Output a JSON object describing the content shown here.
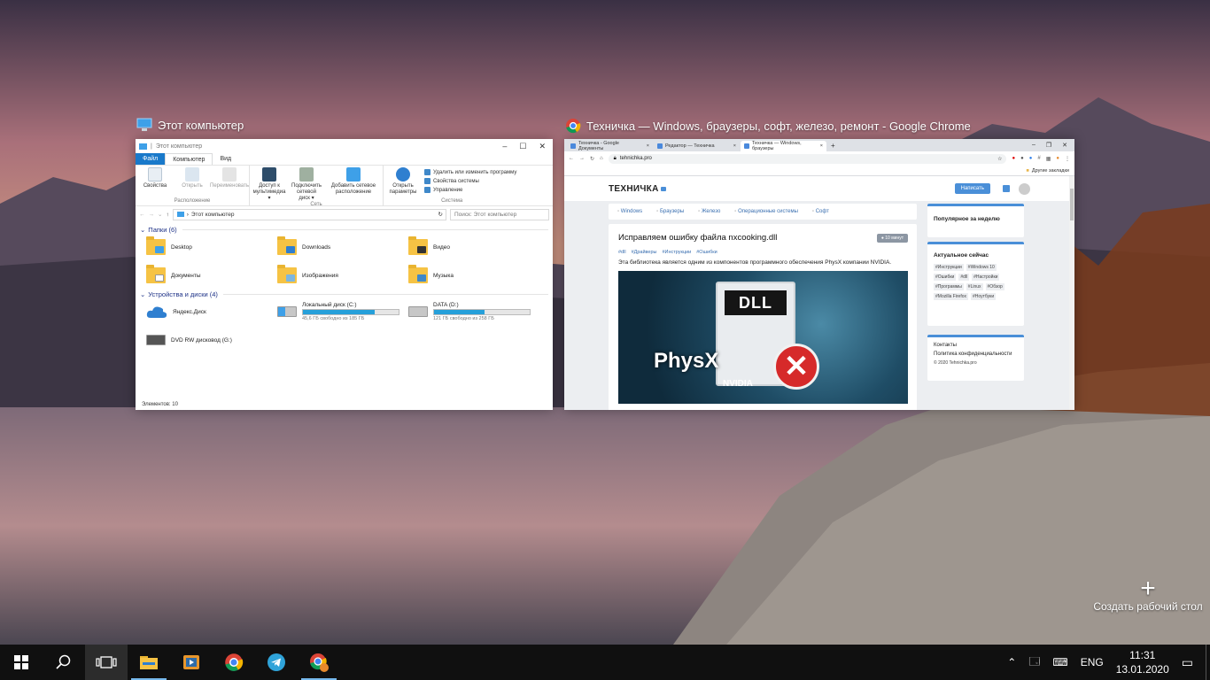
{
  "windows": {
    "explorer": {
      "caption": "Этот компьютер",
      "titlebar_title": "Этот компьютер",
      "tabs": {
        "file": "Файл",
        "computer": "Компьютер",
        "view": "Вид"
      },
      "ribbon": {
        "properties": "Свойства",
        "open": "Открыть",
        "rename": "Переименовать",
        "group_location": "Расположение",
        "media_access": "Доступ к мультимедиа ▾",
        "map_drive": "Подключить сетевой диск ▾",
        "add_location": "Добавить сетевое расположение",
        "group_network": "Сеть",
        "open_settings": "Открыть параметры",
        "uninstall": "Удалить или изменить программу",
        "sys_props": "Свойства системы",
        "manage": "Управление",
        "group_system": "Система"
      },
      "address": {
        "path": "Этот компьютер",
        "search_placeholder": "Поиск: Этот компьютер"
      },
      "folders_header": "Папки (6)",
      "folders": [
        "Desktop",
        "Downloads",
        "Видео",
        "Документы",
        "Изображения",
        "Музыка"
      ],
      "devices_header": "Устройства и диски (4)",
      "devices": {
        "yandex": "Яндекс.Диск",
        "c_name": "Локальный диск (C:)",
        "c_free": "45,6 ГБ свободно из 185 ГБ",
        "c_used_fraction": 0.75,
        "d_name": "DATA (D:)",
        "d_free": "121 ГБ свободно из 258 ГБ",
        "d_used_fraction": 0.53,
        "dvd": "DVD RW дисковод (G:)"
      },
      "status": "Элементов: 10"
    },
    "chrome": {
      "caption": "Техничка — Windows, браузеры, софт, железо, ремонт - Google Chrome",
      "tabs": [
        "Техничка - Google Документы",
        "Редактор — Техничка",
        "Техничка — Windows, браузеры"
      ],
      "url": "tehnichka.pro",
      "bookmarks": "Другие закладки",
      "site": {
        "logo": "ТЕХНИЧКА",
        "write_button": "Написать",
        "nav": [
          "Windows",
          "Браузеры",
          "Железо",
          "Операционные системы",
          "Софт"
        ],
        "post_title": "Исправляем ошибку файла nxcooking.dll",
        "post_time": "10 минут",
        "post_tags": [
          "#dll",
          "#Драйверы",
          "#Инструкции",
          "#Ошибки"
        ],
        "post_text": "Эта библиотека является одним из компонентов программного обеспечения PhysX компании NVIDIA.",
        "img_dll": "DLL",
        "img_physx": "PhysX",
        "img_nvidia": "NVIDIA",
        "popular_title": "Популярное за неделю",
        "trending_title": "Актуальное сейчас",
        "trending_tags": [
          "#Инструкции",
          "#Windows 10",
          "#Ошибки",
          "#dll",
          "#Настройки",
          "#Программы",
          "#Linux",
          "#Обзор",
          "#Mozilla Firefox",
          "#Ноутбуки"
        ],
        "contacts": "Контакты",
        "privacy": "Политика конфиденциальности",
        "copyright": "© 2020 Tehnichka.pro"
      }
    }
  },
  "new_desktop": {
    "plus": "+",
    "label": "Создать рабочий стол"
  },
  "taskbar": {
    "tray_lang": "ENG",
    "time": "11:31",
    "date": "13.01.2020"
  },
  "colors": {
    "accent_blue": "#1979ca",
    "taskbar": "#101010",
    "site_accent": "#4a8fd8"
  }
}
